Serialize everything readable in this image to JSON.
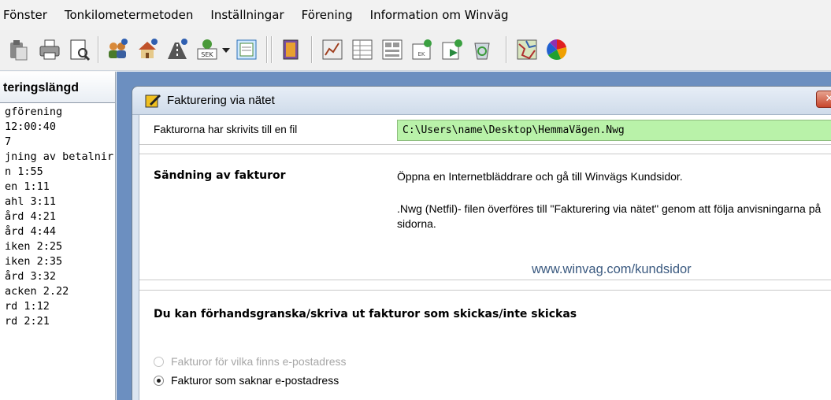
{
  "menu": [
    "Fönster",
    "Tonkilometermetoden",
    "Inställningar",
    "Förening",
    "Information om Winväg"
  ],
  "toolbar": {
    "icons": [
      "paste-icon",
      "print-icon",
      "print-preview-icon",
      "members-icon",
      "house-icon",
      "road-icon",
      "currency-sek-icon",
      "dropdown-arrow-icon",
      "document-icon",
      "book-icon",
      "chart-icon",
      "table-icon",
      "list-icon",
      "new-document-icon",
      "export-icon",
      "recycle-bin-icon",
      "map-icon",
      "color-wheel-icon"
    ],
    "sek_label": "SEK"
  },
  "left_panel": {
    "tab_label": "teringslängd",
    "lines": [
      "gförening",
      "  12:00:40",
      "7",
      "jning av betalnir",
      "n 1:55",
      "en 1:11",
      "ahl 3:11",
      "ård 4:21",
      "ård 4:44",
      "iken 2:25",
      "iken 2:35",
      "ård 3:32",
      "acken 2.22",
      "rd 1:12",
      "rd 2:21"
    ]
  },
  "dialog": {
    "title": "Fakturering via nätet",
    "close_label": "✕",
    "file_row": {
      "label": "Fakturorna har skrivits till en fil",
      "path": "C:\\Users\\name\\Desktop\\HemmaVägen.Nwg"
    },
    "send_section": {
      "heading": "Sändning av fakturor",
      "desc1": "Öppna en Internetbläddrare och gå till Winvägs Kundsidor.",
      "desc2": ".Nwg (Netfil)- filen överföres till \"Fakturering via nätet\" genom att följa anvisningarna på sidorna.",
      "link": "www.winvag.com/kundsidor"
    },
    "preview_section": {
      "heading": "Du kan förhandsgranska/skriva ut fakturor som skickas/inte skickas",
      "options": [
        {
          "label": "Fakturor för vilka finns e-postadress",
          "checked": false,
          "enabled": false
        },
        {
          "label": "Fakturor som saknar e-postadress",
          "checked": true,
          "enabled": true
        }
      ]
    }
  },
  "colors": {
    "accent_path_bg": "#b9f2a9",
    "workspace_bg": "#6c8fc0",
    "link": "#3b5a80",
    "close": "#c8462c"
  }
}
